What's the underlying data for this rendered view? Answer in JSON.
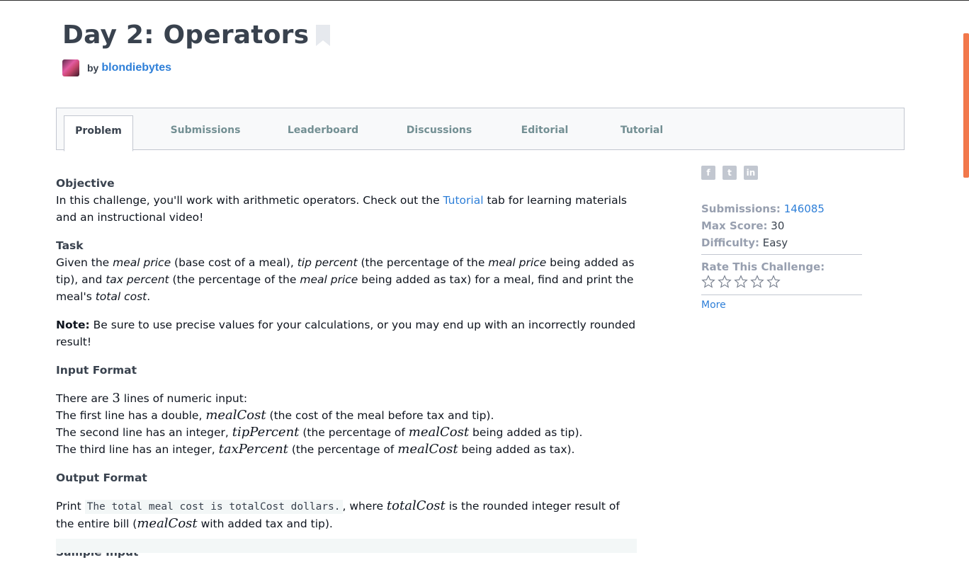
{
  "challenge": {
    "title": "Day 2: Operators",
    "by_label": "by",
    "author": "blondiebytes"
  },
  "tabs": [
    {
      "label": "Problem",
      "active": true
    },
    {
      "label": "Submissions",
      "active": false
    },
    {
      "label": "Leaderboard",
      "active": false
    },
    {
      "label": "Discussions",
      "active": false
    },
    {
      "label": "Editorial",
      "active": false
    },
    {
      "label": "Tutorial",
      "active": false
    }
  ],
  "problem": {
    "objective_heading": "Objective",
    "objective_pre": "In this challenge, you'll work with arithmetic operators. Check out the ",
    "objective_link": "Tutorial",
    "objective_post": " tab for learning materials and an instructional video!",
    "task_heading": "Task",
    "task_t1": "Given the ",
    "task_i1": "meal price",
    "task_t2": " (base cost of a meal), ",
    "task_i2": "tip percent",
    "task_t3": " (the percentage of the ",
    "task_i3": "meal price",
    "task_t4": " being added as tip), and ",
    "task_i4": "tax percent",
    "task_t5": " (the percentage of the ",
    "task_i5": "meal price",
    "task_t6": " being added as tax) for a meal, find and print the meal's ",
    "task_i6": "total cost",
    "task_t7": ".",
    "note_label": "Note:",
    "note_text": " Be sure to use precise values for your calculations, or you may end up with an incorrectly rounded result!",
    "input_heading": "Input Format",
    "in1_a": "There are ",
    "in1_n": "3",
    "in1_b": " lines of numeric input:",
    "in2_a": "The first line has a double, ",
    "in2_m": "mealCost",
    "in2_b": " (the cost of the meal before tax and tip).",
    "in3_a": "The second line has an integer, ",
    "in3_m": "tipPercent",
    "in3_b": " (the percentage of ",
    "in3_m2": "mealCost",
    "in3_c": " being added as tip).",
    "in4_a": "The third line has an integer, ",
    "in4_m": "taxPercent",
    "in4_b": " (the percentage of ",
    "in4_m2": "mealCost",
    "in4_c": " being added as tax).",
    "output_heading": "Output Format",
    "out_a": "Print ",
    "out_code": "The total meal cost is totalCost dollars.",
    "out_b": ", where ",
    "out_m": "totalCost",
    "out_c": " is the rounded integer result of the entire bill (",
    "out_m2": "mealCost",
    "out_d": " with added tax and tip).",
    "sample_heading": "Sample Input"
  },
  "sidebar": {
    "social_icons": [
      "facebook-icon",
      "twitter-icon",
      "linkedin-icon"
    ],
    "submissions_label": "Submissions:",
    "submissions_value": "146085",
    "max_score_label": "Max Score:",
    "max_score_value": "30",
    "difficulty_label": "Difficulty:",
    "difficulty_value": "Easy",
    "rate_label": "Rate This Challenge:",
    "rating_stars_filled": 0,
    "rating_stars_total": 5,
    "more_label": "More"
  },
  "colors": {
    "link": "#2e7fd8",
    "text": "#39424e",
    "muted": "#979faf",
    "scrollbar": "#f2784b"
  }
}
